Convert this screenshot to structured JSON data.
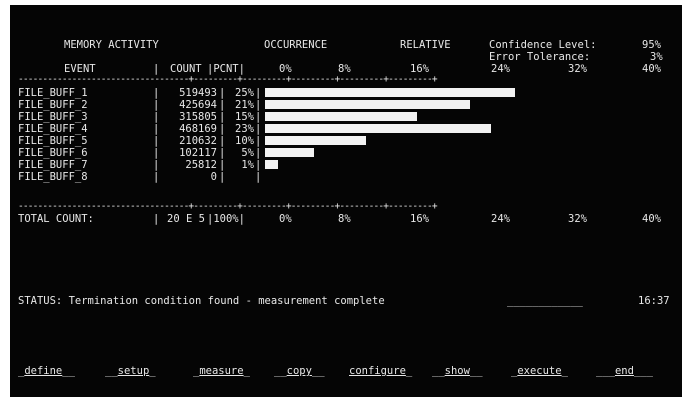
{
  "header": {
    "title": "MEMORY ACTIVITY",
    "occurrence": "OCCURRENCE",
    "relative": "RELATIVE",
    "confidence_label": "Confidence Level:",
    "confidence_value": "95%",
    "tolerance_label": "Error Tolerance:",
    "tolerance_value": "3%"
  },
  "columns": {
    "event": "EVENT",
    "sep1": "|",
    "count": "COUNT",
    "sep2": "|PCNT|",
    "scale": [
      "0%",
      "8%",
      "16%",
      "24%",
      "32%",
      "40%"
    ]
  },
  "rules": {
    "top": "-----------------------------------+---------+---------+---------+---------+---------+",
    "bottom": "-----------------------------------+---------+---------+---------+---------+---------+"
  },
  "chart_data": {
    "type": "bar",
    "categories": [
      "FILE_BUFF_1",
      "FILE_BUFF_2",
      "FILE_BUFF_3",
      "FILE_BUFF_4",
      "FILE_BUFF_5",
      "FILE_BUFF_6",
      "FILE_BUFF_7",
      "FILE_BUFF_8"
    ],
    "counts": [
      "519493",
      "425694",
      "315805",
      "468169",
      "210632",
      "102117",
      "25812",
      "0"
    ],
    "percents": [
      "25%",
      "21%",
      "15%",
      "23%",
      "10%",
      "5%",
      "1%",
      ""
    ],
    "values": [
      25.9,
      21.2,
      15.8,
      23.4,
      10.5,
      5.1,
      1.3,
      0
    ],
    "xlim": [
      0,
      40
    ],
    "tick_labels": [
      "0%",
      "8%",
      "16%",
      "24%",
      "32%",
      "40%"
    ]
  },
  "total": {
    "label": "TOTAL COUNT:",
    "sep": "|",
    "count": "20 E 5",
    "pcnt": "|100%|",
    "scale": [
      "0%",
      "8%",
      "16%",
      "24%",
      "32%",
      "40%"
    ]
  },
  "status": {
    "text": "STATUS: Termination condition found - measurement complete",
    "blank": "____________",
    "time": "16:37"
  },
  "softkeys": [
    "define",
    "setup",
    "measure",
    "copy",
    "configure",
    "show",
    "execute",
    "end"
  ]
}
